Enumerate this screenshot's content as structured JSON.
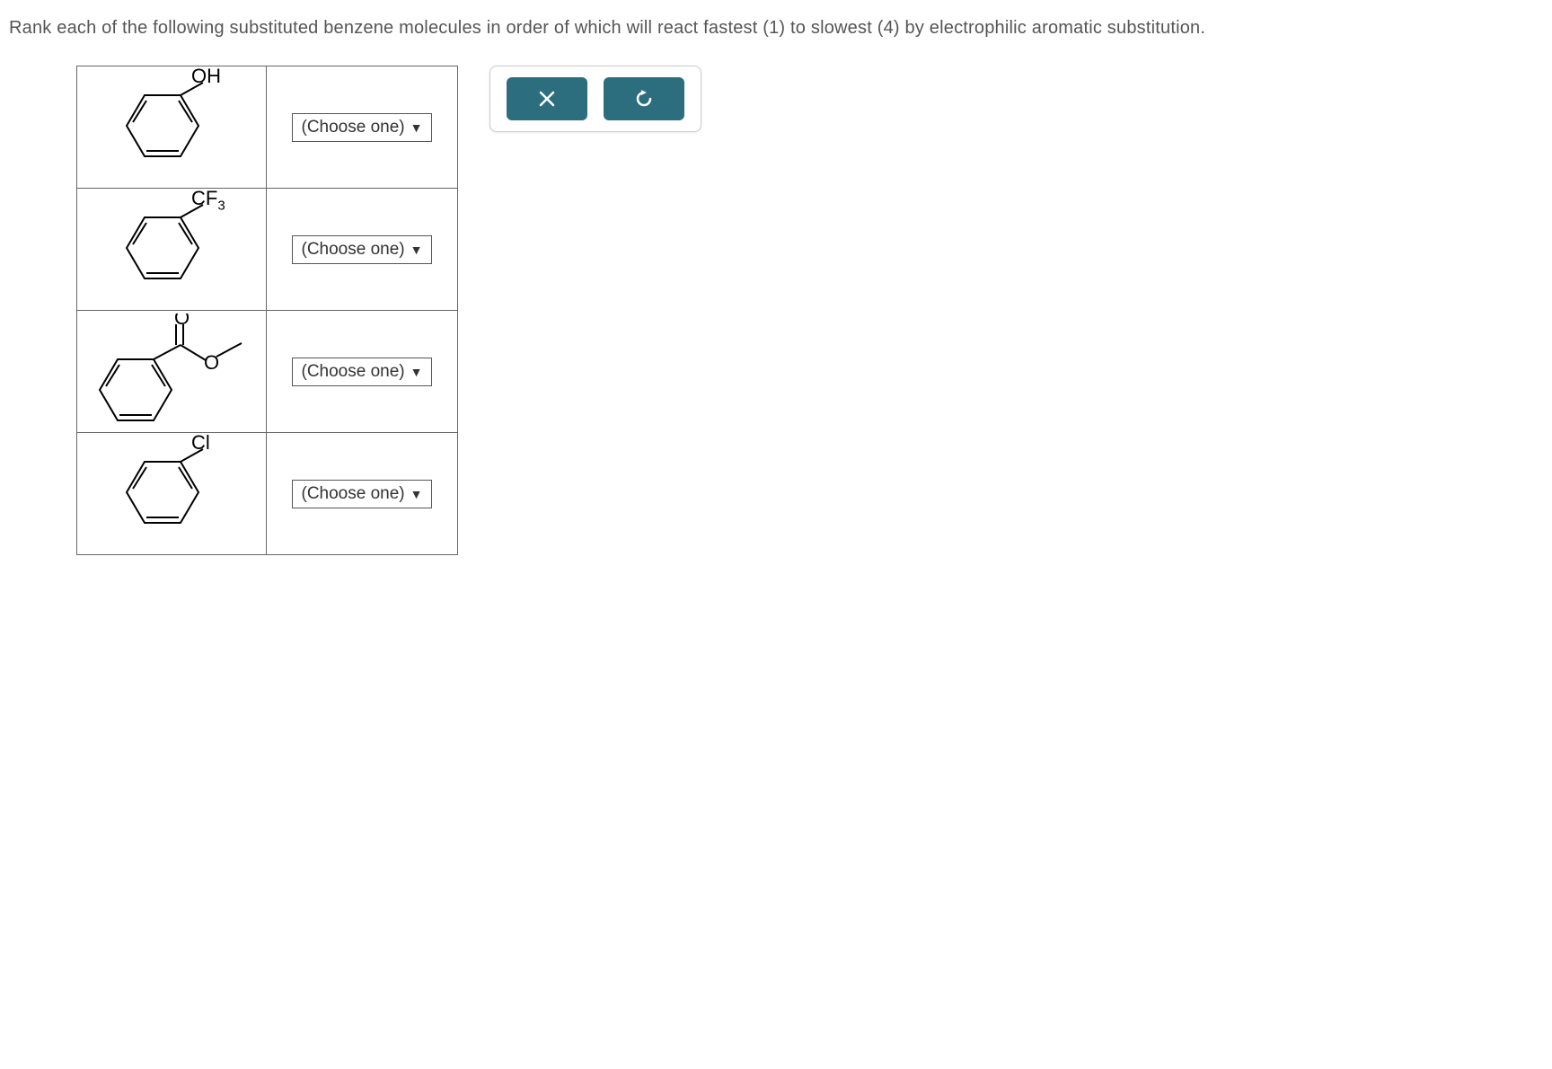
{
  "question": "Rank each of the following substituted benzene molecules in order of which will react fastest (1) to slowest (4) by electrophilic aromatic substitution.",
  "molecules": [
    {
      "substituent": "OH",
      "dropdown": "(Choose one)"
    },
    {
      "substituent": "CF",
      "subscript": "3",
      "dropdown": "(Choose one)"
    },
    {
      "substituent_type": "ester",
      "dropdown": "(Choose one)"
    },
    {
      "substituent": "Cl",
      "dropdown": "(Choose one)"
    }
  ],
  "toolbar": {
    "close": "close",
    "reset": "reset"
  }
}
